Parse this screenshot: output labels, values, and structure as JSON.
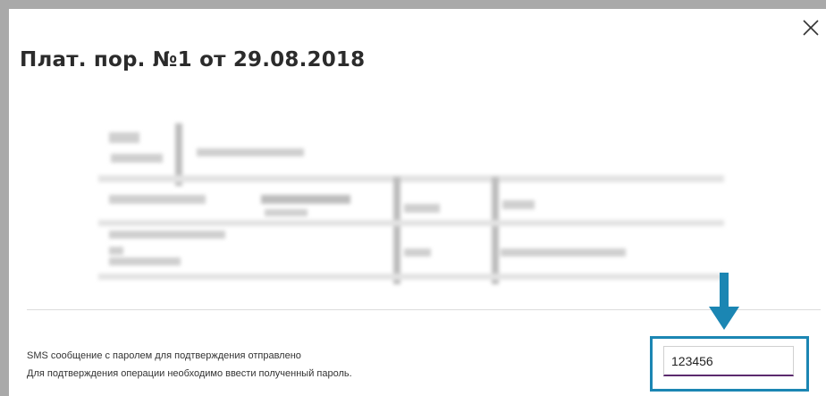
{
  "modal": {
    "title": "Плат. пор. №1 от 29.08.2018",
    "close_icon": "close-icon"
  },
  "confirmation": {
    "line1": "SMS сообщение с паролем для подтверждения отправлено",
    "line2": "Для подтверждения операции необходимо ввести полученный пароль.",
    "password_value": "123456"
  },
  "colors": {
    "highlight": "#1b86b3",
    "input_underline": "#5b2a6e",
    "title": "#2b2b2b"
  },
  "annotation": {
    "arrow_icon": "arrow-down-icon"
  }
}
